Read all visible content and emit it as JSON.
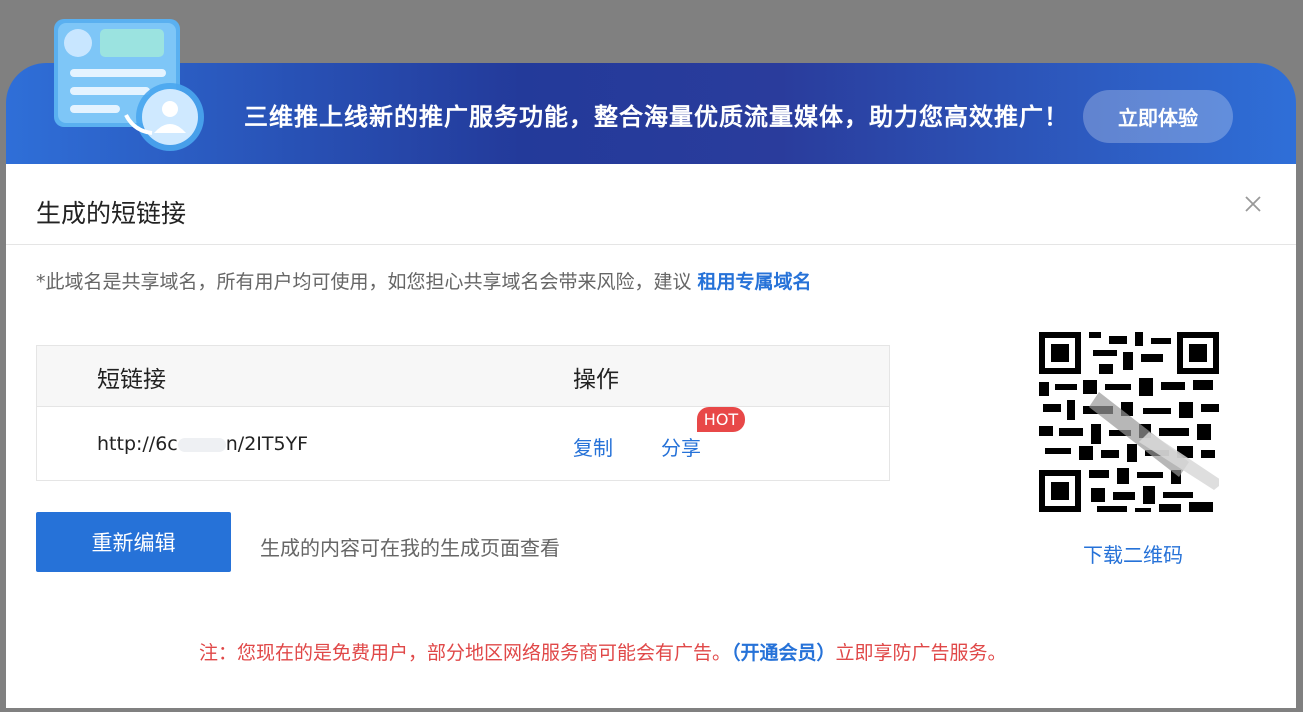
{
  "banner": {
    "text": "三维推上线新的推广服务功能，整合海量优质流量媒体，助力您高效推广！",
    "button": "立即体验"
  },
  "dialog": {
    "title": "生成的短链接",
    "notice_text": "*此域名是共享域名，所有用户均可使用，如您担心共享域名会带来风险，建议 ",
    "notice_link": "租用专属域名",
    "table": {
      "headers": [
        "短链接",
        "操作"
      ],
      "row": {
        "url_prefix": "http://6c",
        "url_suffix": "n/2IT5YF",
        "copy": "复制",
        "share": "分享",
        "badge": "HOT"
      }
    },
    "edit_button": "重新编辑",
    "hint": "生成的内容可在我的生成页面查看",
    "download_qr": "下载二维码",
    "footer_prefix": "注：您现在的是免费用户，部分地区网络服务商可能会有广告。",
    "footer_link": "（开通会员）",
    "footer_suffix": "立即享防广告服务。"
  },
  "colors": {
    "accent": "#2672d8",
    "warning": "#e04848",
    "banner": "#2a3c9c"
  }
}
